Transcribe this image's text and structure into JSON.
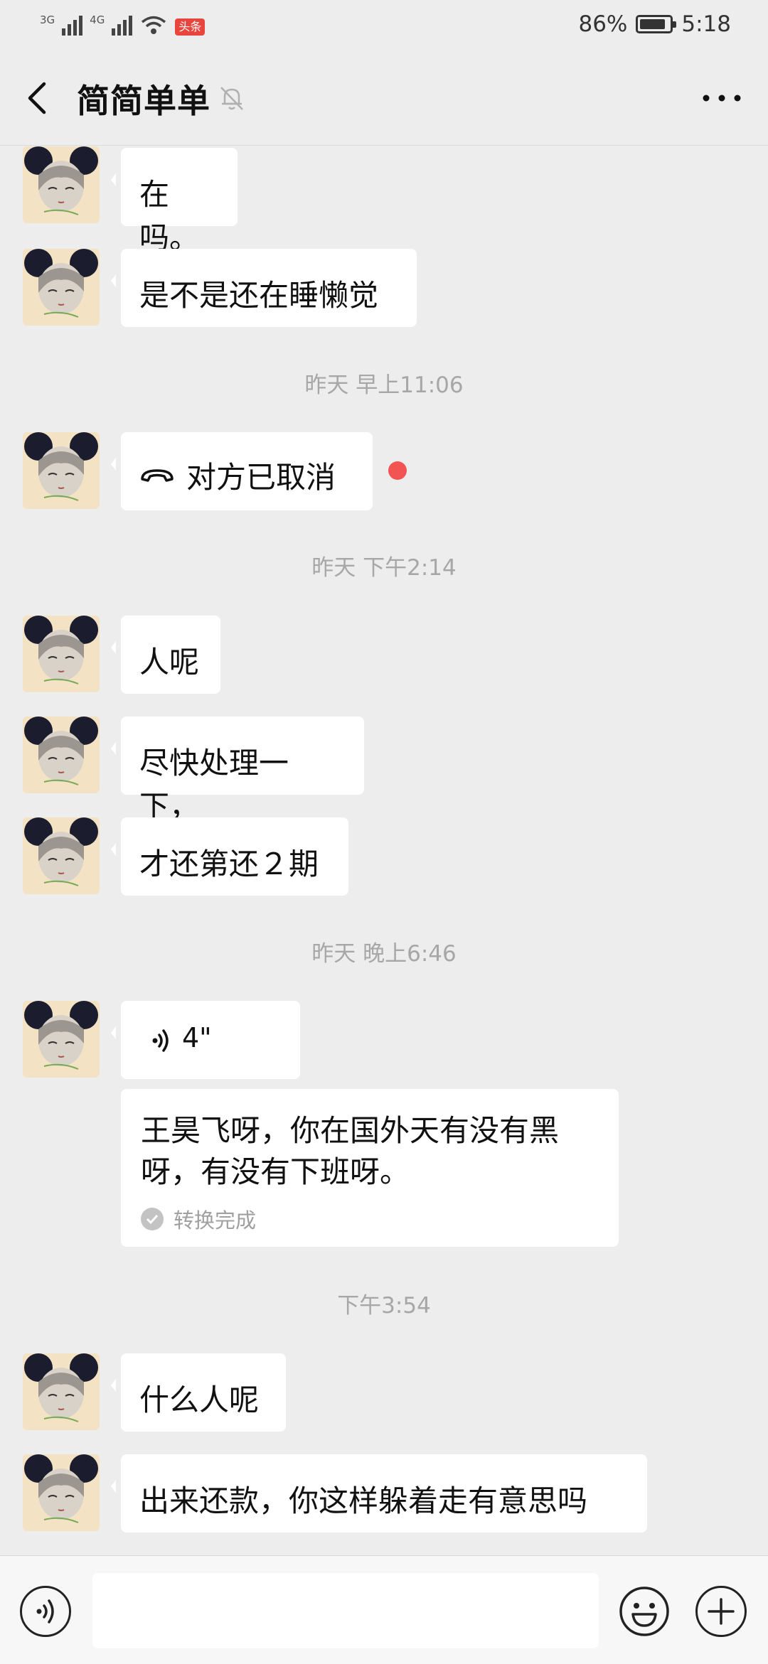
{
  "status_bar": {
    "net1": "3G",
    "net2": "4G",
    "news_badge": "头条",
    "battery_percent": "86%",
    "battery_level": 0.86,
    "time": "5:18"
  },
  "header": {
    "title": "简简单单"
  },
  "messages": {
    "m1": "在吗。",
    "m2": "是不是还在睡懒觉",
    "t1": "昨天 早上11:06",
    "call": "对方已取消",
    "t2": "昨天 下午2:14",
    "m3": "人呢",
    "m4": "尽快处理一下，",
    "m5": "才还第还２期",
    "t3": "昨天 晚上6:46",
    "voice_duration": "4\"",
    "transcript": "王昊飞呀，你在国外天有没有黑呀，有没有下班呀。",
    "transcript_status": "转换完成",
    "t4": "下午3:54",
    "m6": "什么人呢",
    "m7": "出来还款，你这样躲着走有意思吗"
  },
  "input": {
    "placeholder": ""
  },
  "colors": {
    "background": "#ededed",
    "bubble": "#ffffff",
    "unread_dot": "#f25353",
    "timestamp": "#a7a7a7"
  }
}
